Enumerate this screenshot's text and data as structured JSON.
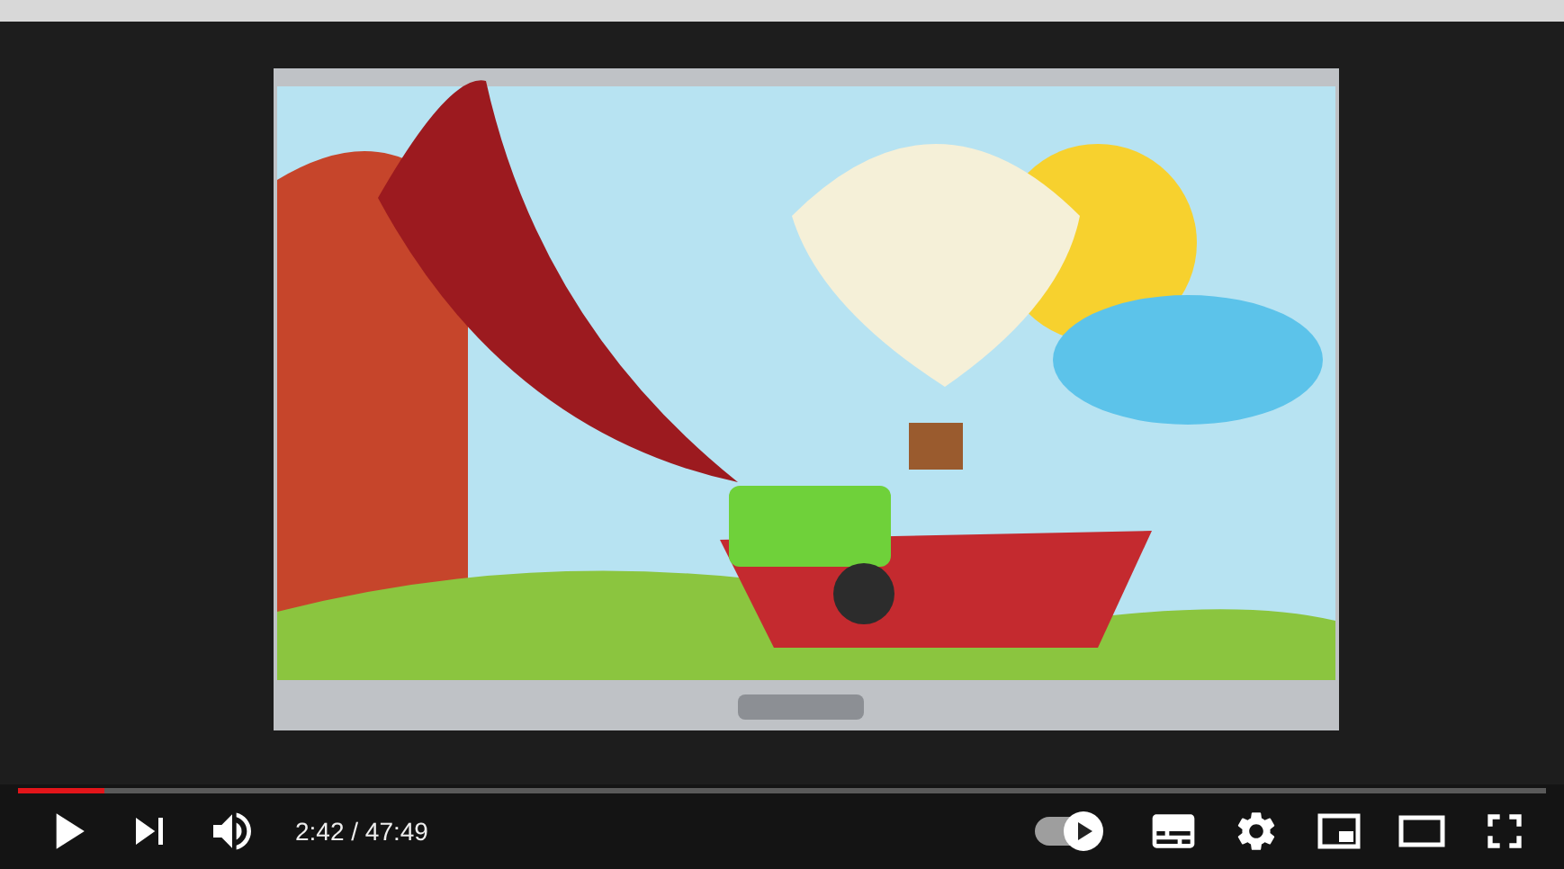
{
  "progress": {
    "level": 0.057
  },
  "controls": {
    "time": "2:42 / 47:49",
    "autoplay": {
      "on": true
    }
  }
}
